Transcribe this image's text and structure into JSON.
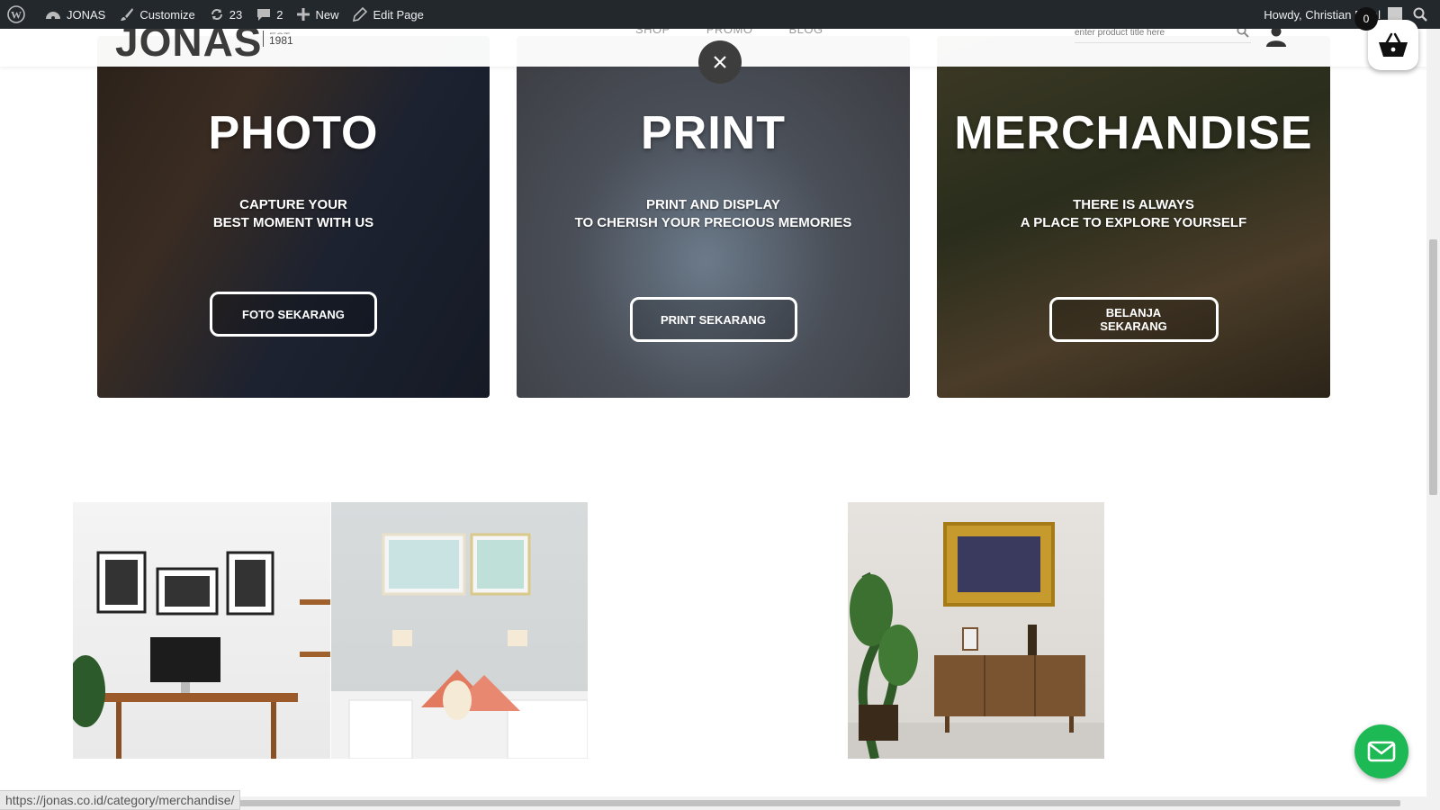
{
  "admin_bar": {
    "site_name": "JONAS",
    "customize": "Customize",
    "updates_count": "23",
    "comments_count": "2",
    "new_label": "New",
    "edit_page": "Edit Page",
    "greeting": "Howdy, Christian Rizal"
  },
  "header": {
    "logo": "JONAS",
    "logo_est": "EST.",
    "logo_year": "1981",
    "nav": [
      "SHOP",
      "PROMO",
      "BLOG"
    ],
    "search_placeholder": "enter product title here"
  },
  "cart": {
    "count": "0"
  },
  "cards": [
    {
      "title": "PHOTO",
      "line1": "CAPTURE YOUR",
      "line2": "BEST MOMENT WITH US",
      "cta": "FOTO SEKARANG"
    },
    {
      "title": "PRINT",
      "line1": "PRINT AND DISPLAY",
      "line2": "TO CHERISH YOUR PRECIOUS MEMORIES",
      "cta": "PRINT SEKARANG"
    },
    {
      "title": "MERCHANDISE",
      "line1": "THERE IS ALWAYS",
      "line2": "A PLACE TO EXPLORE YOURSELF",
      "cta": "BELANJA SEKARANG"
    }
  ],
  "status_url": "https://jonas.co.id/category/merchandise/",
  "colors": {
    "admin_bar": "#23282d",
    "mail_button": "#1db954",
    "close_button": "#3d3d3d"
  },
  "icons": [
    "wordpress-icon",
    "dashboard-icon",
    "brush-icon",
    "updates-icon",
    "comment-icon",
    "plus-icon",
    "pencil-icon",
    "search-icon",
    "user-icon",
    "basket-icon",
    "close-icon",
    "mail-icon"
  ]
}
